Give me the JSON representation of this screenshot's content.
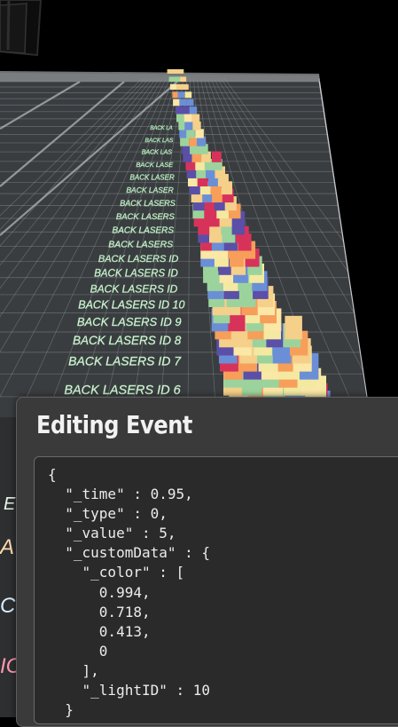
{
  "lane_labels": [
    "BACK LASERS ID 6",
    "BACK LASERS ID 7",
    "BACK LASERS ID 8",
    "BACK LASERS ID 9",
    "BACK LASERS ID 10",
    "BACK LASERS ID",
    "BACK LASERS ID",
    "BACK LASERS ID",
    "BACK LASERS",
    "BACK LASERS",
    "BACK LASERS",
    "BACK LASERS",
    "BACK LASER",
    "BACK LASER",
    "BACK LASE",
    "BACK LAS",
    "BACK LAS",
    "BACK LA"
  ],
  "light_colors": [
    "#f4d08a",
    "#f79e5a",
    "#d7335a",
    "#9cd39c",
    "#6b8fd6",
    "#f3e9a0",
    "#5b4fa8",
    "#fbe7a6"
  ],
  "editor_panel": {
    "title": "Editing Event",
    "code_lines": [
      "{",
      "  \"_time\" : 0.95,",
      "  \"_type\" : 0,",
      "  \"_value\" : 5,",
      "  \"_customData\" : {",
      "    \"_color\" : [",
      "      0.994,",
      "      0.718,",
      "      0.413,",
      "      0",
      "    ],",
      "    \"_lightID\" : 10",
      "  }"
    ]
  }
}
